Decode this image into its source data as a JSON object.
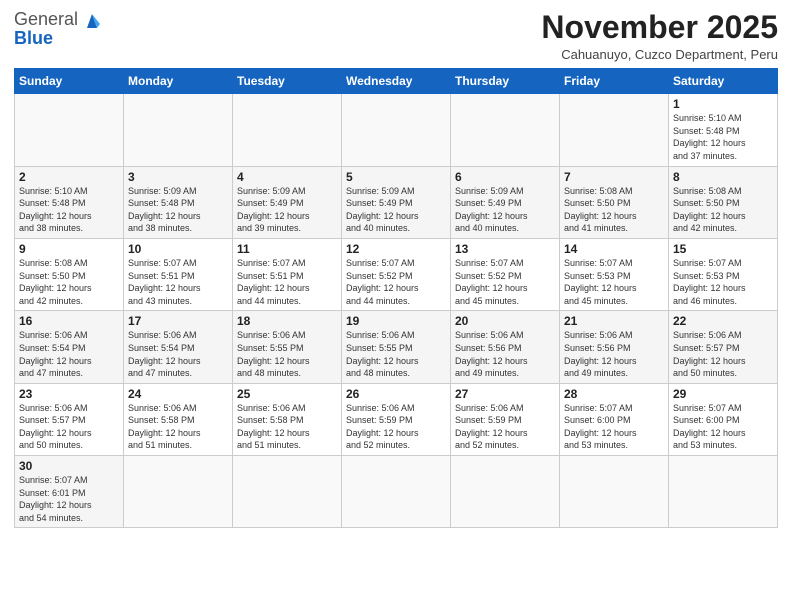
{
  "header": {
    "logo_general": "General",
    "logo_blue": "Blue",
    "title": "November 2025",
    "subtitle": "Cahuanuyo, Cuzco Department, Peru"
  },
  "weekdays": [
    "Sunday",
    "Monday",
    "Tuesday",
    "Wednesday",
    "Thursday",
    "Friday",
    "Saturday"
  ],
  "weeks": [
    [
      {
        "day": "",
        "info": ""
      },
      {
        "day": "",
        "info": ""
      },
      {
        "day": "",
        "info": ""
      },
      {
        "day": "",
        "info": ""
      },
      {
        "day": "",
        "info": ""
      },
      {
        "day": "",
        "info": ""
      },
      {
        "day": "1",
        "info": "Sunrise: 5:10 AM\nSunset: 5:48 PM\nDaylight: 12 hours\nand 37 minutes."
      }
    ],
    [
      {
        "day": "2",
        "info": "Sunrise: 5:10 AM\nSunset: 5:48 PM\nDaylight: 12 hours\nand 38 minutes."
      },
      {
        "day": "3",
        "info": "Sunrise: 5:09 AM\nSunset: 5:48 PM\nDaylight: 12 hours\nand 38 minutes."
      },
      {
        "day": "4",
        "info": "Sunrise: 5:09 AM\nSunset: 5:49 PM\nDaylight: 12 hours\nand 39 minutes."
      },
      {
        "day": "5",
        "info": "Sunrise: 5:09 AM\nSunset: 5:49 PM\nDaylight: 12 hours\nand 40 minutes."
      },
      {
        "day": "6",
        "info": "Sunrise: 5:09 AM\nSunset: 5:49 PM\nDaylight: 12 hours\nand 40 minutes."
      },
      {
        "day": "7",
        "info": "Sunrise: 5:08 AM\nSunset: 5:50 PM\nDaylight: 12 hours\nand 41 minutes."
      },
      {
        "day": "8",
        "info": "Sunrise: 5:08 AM\nSunset: 5:50 PM\nDaylight: 12 hours\nand 42 minutes."
      }
    ],
    [
      {
        "day": "9",
        "info": "Sunrise: 5:08 AM\nSunset: 5:50 PM\nDaylight: 12 hours\nand 42 minutes."
      },
      {
        "day": "10",
        "info": "Sunrise: 5:07 AM\nSunset: 5:51 PM\nDaylight: 12 hours\nand 43 minutes."
      },
      {
        "day": "11",
        "info": "Sunrise: 5:07 AM\nSunset: 5:51 PM\nDaylight: 12 hours\nand 44 minutes."
      },
      {
        "day": "12",
        "info": "Sunrise: 5:07 AM\nSunset: 5:52 PM\nDaylight: 12 hours\nand 44 minutes."
      },
      {
        "day": "13",
        "info": "Sunrise: 5:07 AM\nSunset: 5:52 PM\nDaylight: 12 hours\nand 45 minutes."
      },
      {
        "day": "14",
        "info": "Sunrise: 5:07 AM\nSunset: 5:53 PM\nDaylight: 12 hours\nand 45 minutes."
      },
      {
        "day": "15",
        "info": "Sunrise: 5:07 AM\nSunset: 5:53 PM\nDaylight: 12 hours\nand 46 minutes."
      }
    ],
    [
      {
        "day": "16",
        "info": "Sunrise: 5:06 AM\nSunset: 5:54 PM\nDaylight: 12 hours\nand 47 minutes."
      },
      {
        "day": "17",
        "info": "Sunrise: 5:06 AM\nSunset: 5:54 PM\nDaylight: 12 hours\nand 47 minutes."
      },
      {
        "day": "18",
        "info": "Sunrise: 5:06 AM\nSunset: 5:55 PM\nDaylight: 12 hours\nand 48 minutes."
      },
      {
        "day": "19",
        "info": "Sunrise: 5:06 AM\nSunset: 5:55 PM\nDaylight: 12 hours\nand 48 minutes."
      },
      {
        "day": "20",
        "info": "Sunrise: 5:06 AM\nSunset: 5:56 PM\nDaylight: 12 hours\nand 49 minutes."
      },
      {
        "day": "21",
        "info": "Sunrise: 5:06 AM\nSunset: 5:56 PM\nDaylight: 12 hours\nand 49 minutes."
      },
      {
        "day": "22",
        "info": "Sunrise: 5:06 AM\nSunset: 5:57 PM\nDaylight: 12 hours\nand 50 minutes."
      }
    ],
    [
      {
        "day": "23",
        "info": "Sunrise: 5:06 AM\nSunset: 5:57 PM\nDaylight: 12 hours\nand 50 minutes."
      },
      {
        "day": "24",
        "info": "Sunrise: 5:06 AM\nSunset: 5:58 PM\nDaylight: 12 hours\nand 51 minutes."
      },
      {
        "day": "25",
        "info": "Sunrise: 5:06 AM\nSunset: 5:58 PM\nDaylight: 12 hours\nand 51 minutes."
      },
      {
        "day": "26",
        "info": "Sunrise: 5:06 AM\nSunset: 5:59 PM\nDaylight: 12 hours\nand 52 minutes."
      },
      {
        "day": "27",
        "info": "Sunrise: 5:06 AM\nSunset: 5:59 PM\nDaylight: 12 hours\nand 52 minutes."
      },
      {
        "day": "28",
        "info": "Sunrise: 5:07 AM\nSunset: 6:00 PM\nDaylight: 12 hours\nand 53 minutes."
      },
      {
        "day": "29",
        "info": "Sunrise: 5:07 AM\nSunset: 6:00 PM\nDaylight: 12 hours\nand 53 minutes."
      }
    ],
    [
      {
        "day": "30",
        "info": "Sunrise: 5:07 AM\nSunset: 6:01 PM\nDaylight: 12 hours\nand 54 minutes."
      },
      {
        "day": "",
        "info": ""
      },
      {
        "day": "",
        "info": ""
      },
      {
        "day": "",
        "info": ""
      },
      {
        "day": "",
        "info": ""
      },
      {
        "day": "",
        "info": ""
      },
      {
        "day": "",
        "info": ""
      }
    ]
  ]
}
